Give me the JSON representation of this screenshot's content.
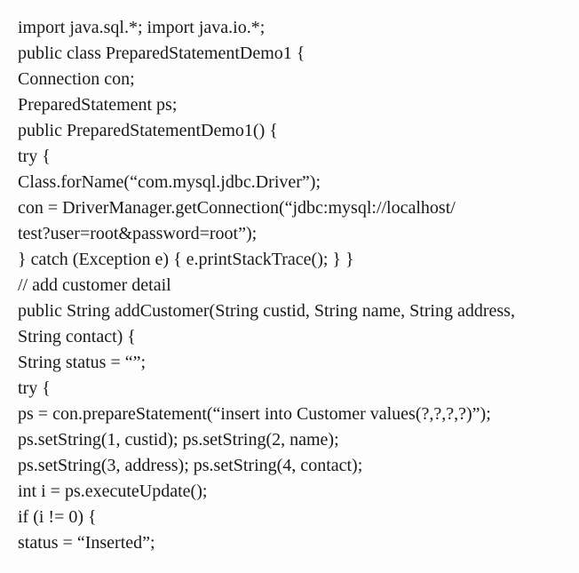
{
  "code": {
    "l01": "import java.sql.*; import java.io.*;",
    "l02": "public class PreparedStatementDemo1 {",
    "l03": "Connection con;",
    "l04": "PreparedStatement ps;",
    "l05": "public PreparedStatementDemo1() {",
    "l06": "try {",
    "l07": "Class.forName(“com.mysql.jdbc.Driver”);",
    "l08": "con = DriverManager.getConnection(“jdbc:mysql://localhost/",
    "l09": "test?user=root&password=root”);",
    "l10": "} catch (Exception e) { e.printStackTrace(); } }",
    "l11": "// add customer detail",
    "l12": "public String addCustomer(String custid, String name, String address,",
    "l13": "String contact) {",
    "l14": "String status = “”;",
    "l15": "try {",
    "l16": "ps = con.prepareStatement(“insert into Customer values(?,?,?,?)”);",
    "l17": "ps.setString(1, custid); ps.setString(2, name);",
    "l18": "ps.setString(3, address); ps.setString(4, contact);",
    "l19": "int i = ps.executeUpdate();",
    "l20": "if (i != 0) {",
    "l21": "status = “Inserted”;"
  }
}
